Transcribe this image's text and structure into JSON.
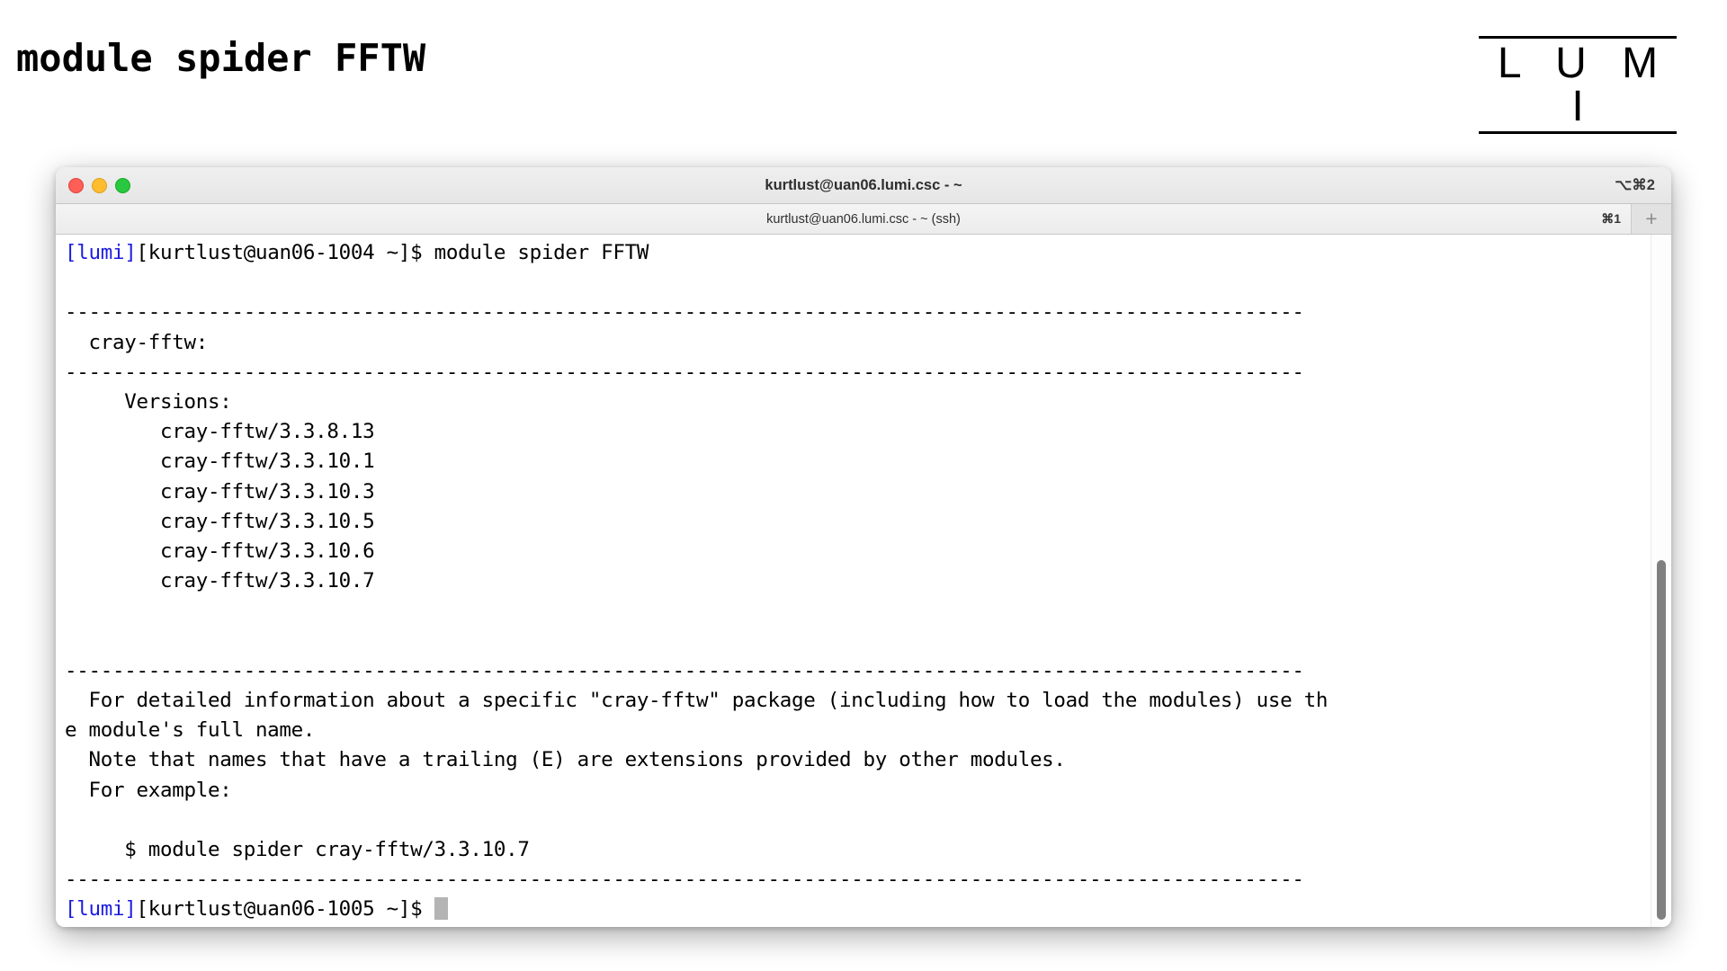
{
  "slide": {
    "title": "module spider FFTW",
    "logo": {
      "text": "L U M I"
    }
  },
  "terminal": {
    "title_bar": {
      "title": "kurtlust@uan06.lumi.csc - ~",
      "shortcut": "⌥⌘2",
      "buttons": {
        "close": "close",
        "minimize": "minimize",
        "maximize": "maximize"
      }
    },
    "tab_bar": {
      "tab_title": "kurtlust@uan06.lumi.csc - ~ (ssh)",
      "shortcut": "⌘1",
      "new_tab": "+"
    },
    "prompt_prefix": "[lumi]",
    "lines": [
      {
        "prefix": "[lumi]",
        "text": "[kurtlust@uan06-1004 ~]$ module spider FFTW"
      },
      {
        "text": ""
      },
      {
        "text": "--------------------------------------------------------------------------------------------------------"
      },
      {
        "text": "  cray-fftw:"
      },
      {
        "text": "--------------------------------------------------------------------------------------------------------"
      },
      {
        "text": "     Versions:"
      },
      {
        "text": "        cray-fftw/3.3.8.13"
      },
      {
        "text": "        cray-fftw/3.3.10.1"
      },
      {
        "text": "        cray-fftw/3.3.10.3"
      },
      {
        "text": "        cray-fftw/3.3.10.5"
      },
      {
        "text": "        cray-fftw/3.3.10.6"
      },
      {
        "text": "        cray-fftw/3.3.10.7"
      },
      {
        "text": ""
      },
      {
        "text": ""
      },
      {
        "text": "--------------------------------------------------------------------------------------------------------"
      },
      {
        "text": "  For detailed information about a specific \"cray-fftw\" package (including how to load the modules) use th"
      },
      {
        "text": "e module's full name."
      },
      {
        "text": "  Note that names that have a trailing (E) are extensions provided by other modules."
      },
      {
        "text": "  For example:"
      },
      {
        "text": ""
      },
      {
        "text": "     $ module spider cray-fftw/3.3.10.7"
      },
      {
        "text": "--------------------------------------------------------------------------------------------------------"
      },
      {
        "prefix": "[lumi]",
        "text": "[kurtlust@uan06-1005 ~]$ ",
        "cursor": true
      }
    ]
  },
  "colors": {
    "prompt_blue": "#1c1ce0",
    "text_black": "#000000",
    "cursor_grey": "#b4b4b4",
    "scrollbar_thumb": "#808080"
  }
}
